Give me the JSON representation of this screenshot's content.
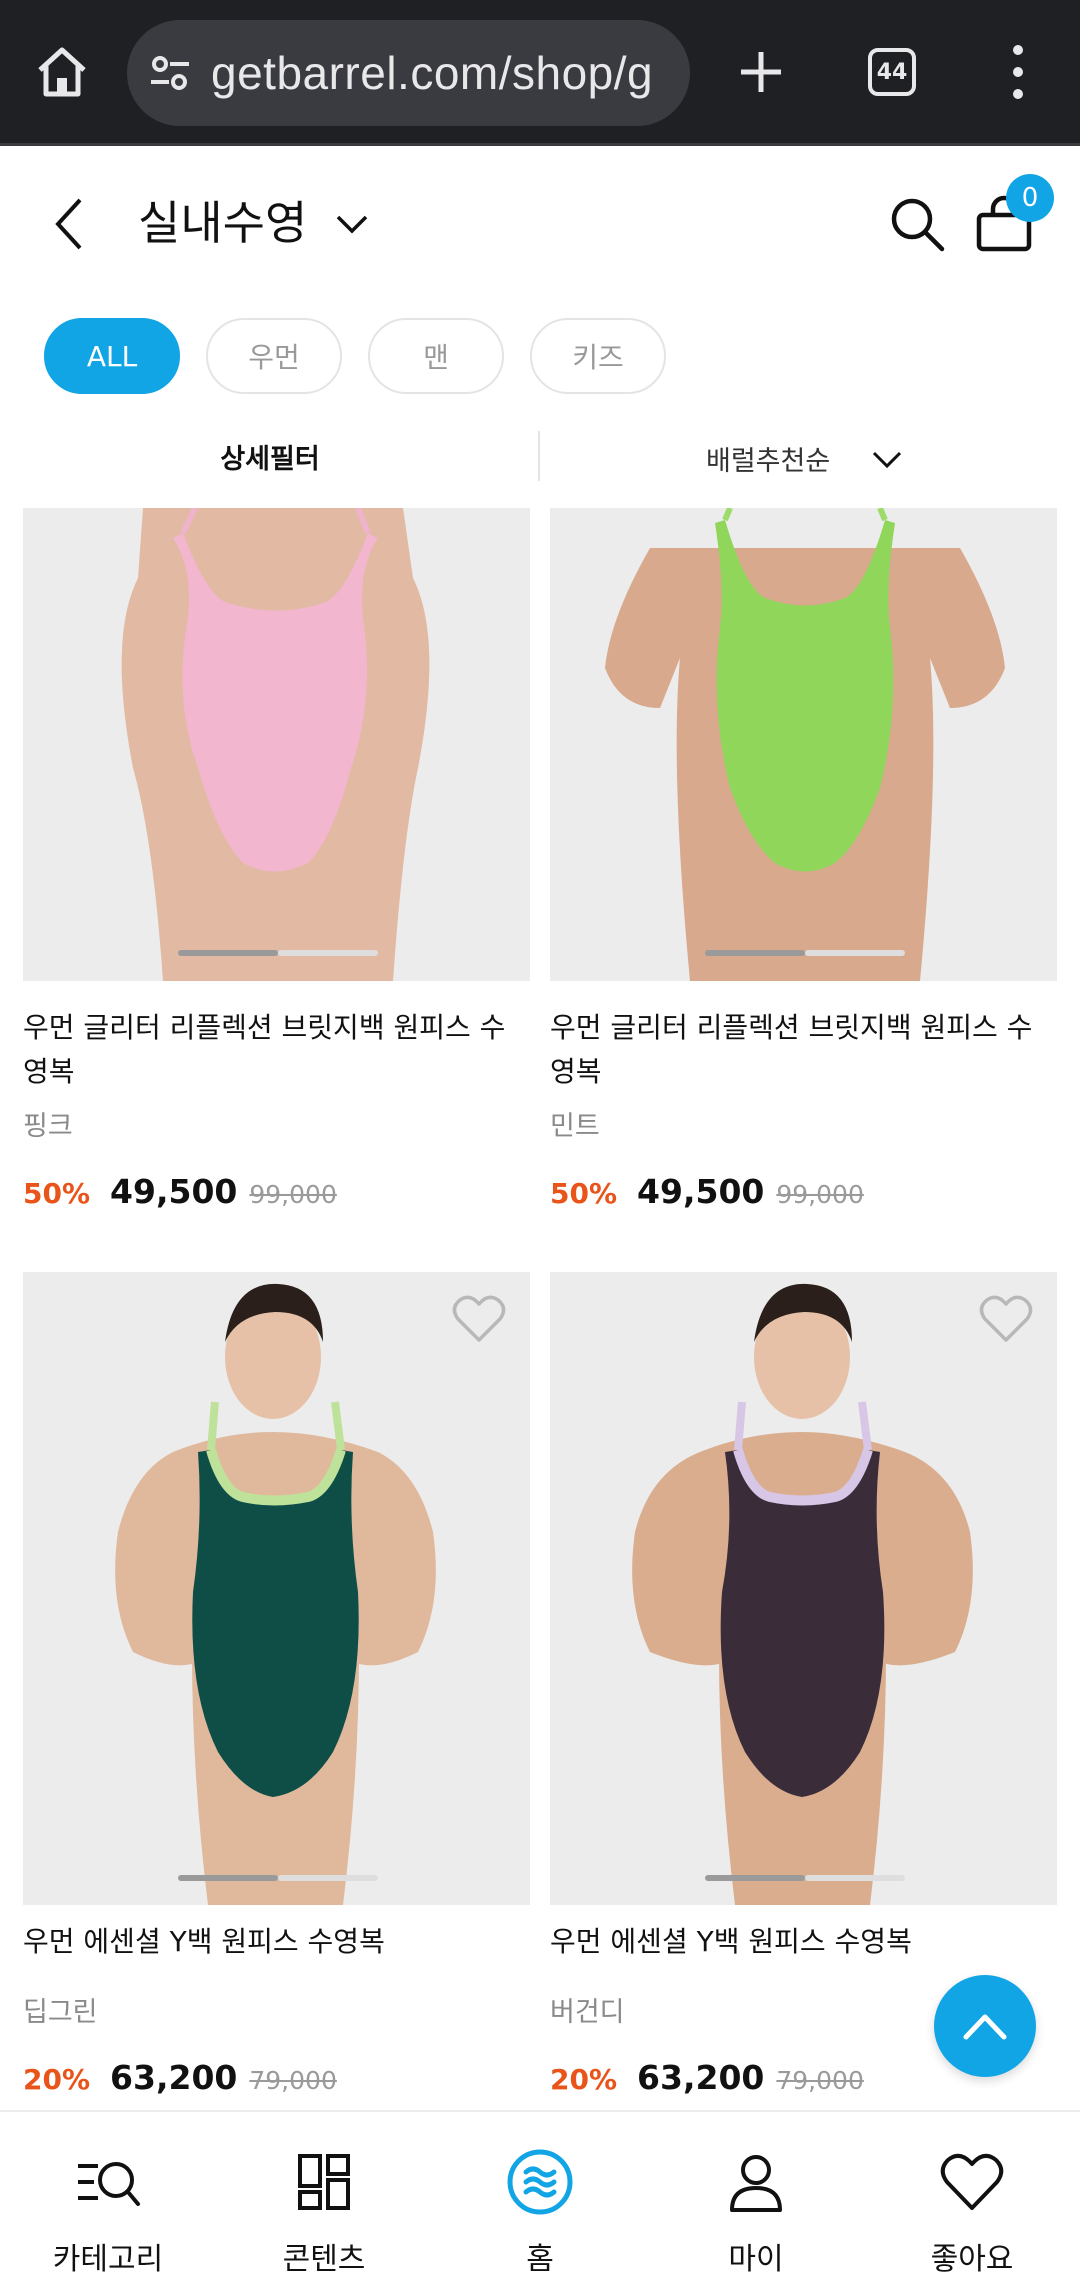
{
  "browser": {
    "url": "getbarrel.com/shop/g",
    "tab_count": "44"
  },
  "header": {
    "title": "실내수영",
    "cart_count": "0"
  },
  "filters": {
    "chips": [
      {
        "label": "ALL",
        "active": true
      },
      {
        "label": "우먼",
        "active": false
      },
      {
        "label": "맨",
        "active": false
      },
      {
        "label": "키즈",
        "active": false
      }
    ],
    "detail_filter_label": "상세필터",
    "sort_label": "배럴추천순"
  },
  "products": [
    {
      "name": "우먼 글리터 리플렉션 브릿지백 원피스 수영복",
      "color": "핑크",
      "discount": "50%",
      "price": "49,500",
      "original_price": "99,000",
      "swatch": "#f2b6cf",
      "strap": "#efb3cc"
    },
    {
      "name": "우먼 글리터 리플렉션 브릿지백 원피스 수영복",
      "color": "민트",
      "discount": "50%",
      "price": "49,500",
      "original_price": "99,000",
      "swatch": "#8fd65a",
      "strap": "#9ddc6a"
    },
    {
      "name": "우먼 에센셜 Y백 원피스 수영복",
      "color": "딥그린",
      "discount": "20%",
      "price": "63,200",
      "original_price": "79,000",
      "swatch": "#0f4d47",
      "strap": "#bfe29b"
    },
    {
      "name": "우먼 에센셜 Y백 원피스 수영복",
      "color": "버건디",
      "discount": "20%",
      "price": "63,200",
      "original_price": "79,000",
      "swatch": "#3b2c3a",
      "strap": "#d7c6e6"
    }
  ],
  "bottom_nav": [
    {
      "label": "카테고리",
      "icon": "category-search-icon"
    },
    {
      "label": "콘텐츠",
      "icon": "grid-icon"
    },
    {
      "label": "홈",
      "icon": "home-logo-icon"
    },
    {
      "label": "마이",
      "icon": "person-icon"
    },
    {
      "label": "좋아요",
      "icon": "heart-icon"
    }
  ],
  "colors": {
    "accent": "#12a5e6",
    "discount": "#e8541a"
  }
}
